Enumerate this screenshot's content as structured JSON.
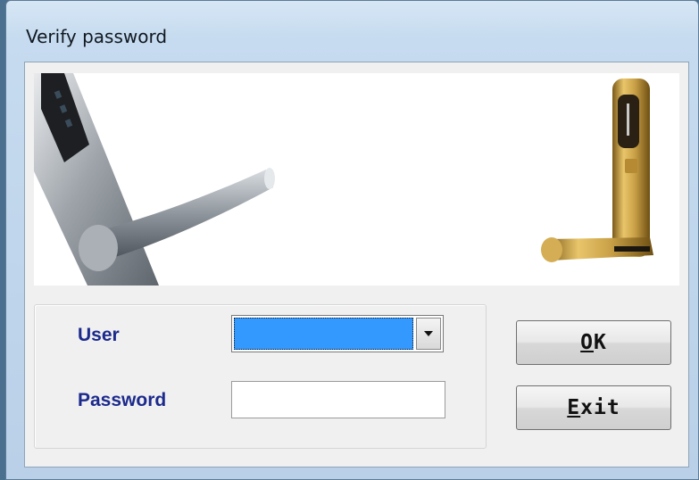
{
  "window": {
    "title": "Verify password"
  },
  "banner": {
    "left_image": "silver-door-lock",
    "right_image": "gold-door-lock"
  },
  "form": {
    "user_label": "User",
    "user_value": "",
    "password_label": "Password",
    "password_value": ""
  },
  "buttons": {
    "ok_mnemonic": "O",
    "ok_rest": "K",
    "exit_mnemonic": "E",
    "exit_rest": "xit"
  },
  "colors": {
    "label": "#1c2a8c",
    "selection": "#3399ff"
  }
}
